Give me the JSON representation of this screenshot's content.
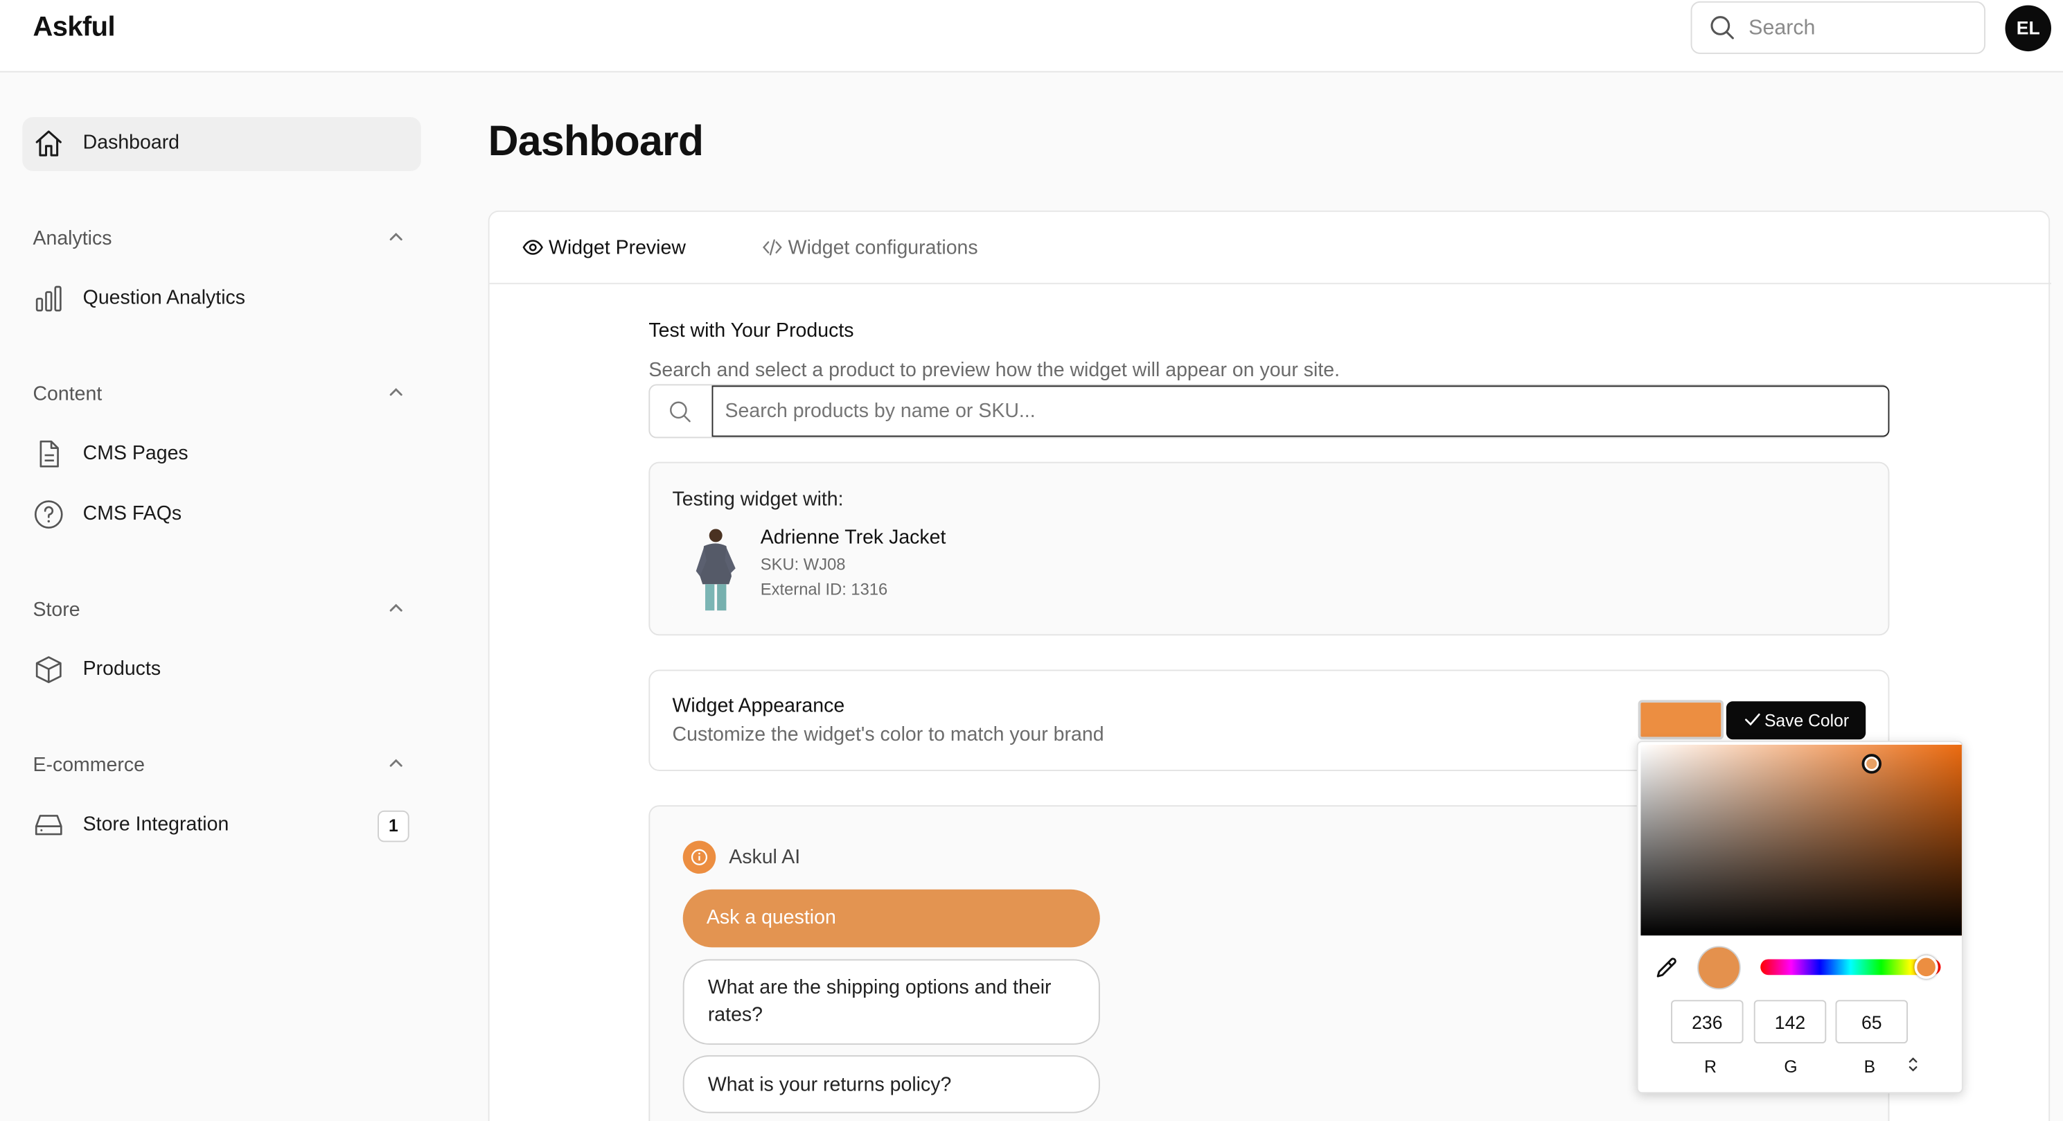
{
  "app": {
    "name": "Askful",
    "user_initials": "EL"
  },
  "header": {
    "search_placeholder": "Search"
  },
  "sidebar": {
    "dashboard": "Dashboard",
    "sections": [
      {
        "title": "Analytics",
        "items": [
          {
            "label": "Question Analytics",
            "icon": "bar-chart-icon"
          }
        ]
      },
      {
        "title": "Content",
        "items": [
          {
            "label": "CMS Pages",
            "icon": "document-icon"
          },
          {
            "label": "CMS FAQs",
            "icon": "question-circle-icon"
          }
        ]
      },
      {
        "title": "Store",
        "items": [
          {
            "label": "Products",
            "icon": "box-icon"
          }
        ]
      },
      {
        "title": "E-commerce",
        "items": [
          {
            "label": "Store Integration",
            "icon": "drive-icon",
            "badge": "1"
          }
        ]
      }
    ]
  },
  "page": {
    "title": "Dashboard"
  },
  "tabs": [
    {
      "label": "Widget Preview",
      "icon": "eye-icon",
      "active": true
    },
    {
      "label": "Widget configurations",
      "icon": "code-icon",
      "active": false
    }
  ],
  "test": {
    "heading": "Test with Your Products",
    "description": "Search and select a product to preview how the widget will appear on your site.",
    "search_placeholder": "Search products by name or SKU...",
    "testing_label": "Testing widget with:",
    "product": {
      "name": "Adrienne Trek Jacket",
      "sku": "SKU: WJ08",
      "external_id": "External ID: 1316"
    }
  },
  "appearance": {
    "title": "Widget Appearance",
    "description": "Customize the widget's color to match your brand",
    "save_label": "Save Color",
    "color": "#ec8e41"
  },
  "widget": {
    "assistant_name": "Askul AI",
    "ask_label": "Ask a question",
    "questions": [
      "What are the shipping options and their rates?",
      "What is your returns policy?"
    ]
  },
  "picker": {
    "r": "236",
    "g": "142",
    "b": "65",
    "labels": {
      "r": "R",
      "g": "G",
      "b": "B"
    }
  }
}
